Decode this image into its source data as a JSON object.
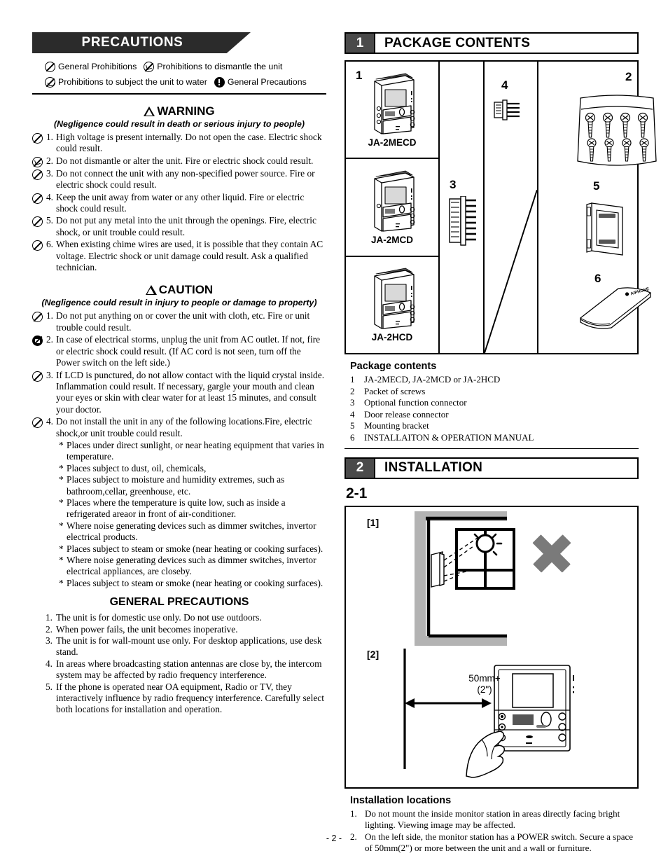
{
  "left": {
    "banner_title": "PRECAUTIONS",
    "legend": [
      {
        "icon": "general-prohibition-icon",
        "label": "General Prohibitions"
      },
      {
        "icon": "dismantle-prohibition-icon",
        "label": "Prohibitions to dismantle the unit"
      },
      {
        "icon": "water-prohibition-icon",
        "label": "Prohibitions to subject the unit to water"
      },
      {
        "icon": "general-precaution-icon",
        "label": "General Precautions"
      }
    ],
    "warning": {
      "title": "WARNING",
      "subtitle": "(Negligence could result in death or serious injury to people)",
      "items": [
        {
          "num": "1.",
          "icon": "general-prohibition-icon",
          "text": "High voltage is present internally. Do not open the case.  Electric shock could result."
        },
        {
          "num": "2.",
          "icon": "dismantle-prohibition-icon",
          "text": "Do not dismantle or alter the unit.  Fire or electric shock could result."
        },
        {
          "num": "3.",
          "icon": "general-prohibition-icon",
          "text": "Do not connect the unit with any non-specified power source. Fire or electric shock could result."
        },
        {
          "num": "4.",
          "icon": "general-prohibition-icon",
          "text": "Keep the unit away from water or any other liquid. Fire or electric shock could result."
        },
        {
          "num": "5.",
          "icon": "general-prohibition-icon",
          "text": "Do not put any metal into the unit through the openings. Fire, electric shock, or unit trouble could result."
        },
        {
          "num": "6.",
          "icon": "general-prohibition-icon",
          "text": "When existing chime wires are used, it is possible that they contain AC voltage. Electric shock or unit damage could result.  Ask a qualified technician."
        }
      ]
    },
    "caution": {
      "title": "CAUTION",
      "subtitle": "(Negligence could result in injury to people or damage to property)",
      "items": [
        {
          "num": "1.",
          "icon": "general-prohibition-icon",
          "text": "Do not put anything on or cover the unit with cloth, etc. Fire or unit trouble could result."
        },
        {
          "num": "2.",
          "icon": "unplug-precaution-icon",
          "text": "In case of electrical storms, unplug the unit from AC outlet. If not, fire or electric shock could result. (If AC cord is not seen, turn off the Power switch on the left side.)"
        },
        {
          "num": "3.",
          "icon": "general-prohibition-icon",
          "text": "If LCD is punctured, do not allow contact with the liquid crystal inside. Inflammation could result. If necessary, gargle your mouth and clean your eyes or skin with clear water for at least 15 minutes, and consult your doctor."
        },
        {
          "num": "4.",
          "icon": "general-prohibition-icon",
          "text": "Do not install the unit in any of the following locations.Fire, electric shock,or unit trouble could result."
        }
      ],
      "sub_items": [
        "Places under direct sunlight, or near heating equipment that varies in temperature.",
        "Places subject to dust, oil, chemicals,",
        "Places subject to moisture and humidity extremes, such as bathroom,cellar, greenhouse, etc.",
        "Places where the temperature is quite low, such as inside a refrigerated areaor in front of air-conditioner.",
        "Where noise generating devices such as dimmer switches, invertor electrical products.",
        "Places subject to steam or smoke (near heating or cooking surfaces).",
        "Where noise generating devices such as dimmer switches, invertor electrical appliances, are closeby.",
        "Places subject to steam or smoke (near heating or cooking surfaces)."
      ]
    },
    "general_precautions": {
      "title": "GENERAL PRECAUTIONS",
      "items": [
        {
          "num": "1.",
          "text": "The unit is for domestic use only. Do not use outdoors."
        },
        {
          "num": "2.",
          "text": "When power fails, the unit becomes inoperative."
        },
        {
          "num": "3.",
          "text": "The unit is for wall-mount use only. For desktop applications, use desk stand."
        },
        {
          "num": "4.",
          "text": "In areas where broadcasting station antennas are close by, the intercom system may be affected by radio frequency interference."
        },
        {
          "num": "5.",
          "text": "If the phone is operated near OA equipment, Radio or TV, they interactively influence by radio frequency interference. Carefully select both locations for installation and operation."
        }
      ]
    }
  },
  "right": {
    "section1": {
      "number": "1",
      "title": "PACKAGE CONTENTS",
      "diagram": {
        "monitors": [
          {
            "index": "1",
            "label": "JA-2MECD"
          },
          {
            "index": "",
            "label": "JA-2MCD"
          },
          {
            "index": "",
            "label": "JA-2HCD"
          }
        ],
        "connector_optional_index": "3",
        "connector_door_index": "4",
        "screws_index": "2",
        "bracket_index": "5",
        "manual_index": "6"
      },
      "list_title": "Package contents",
      "list": [
        {
          "n": "1",
          "text": "JA-2MECD, JA-2MCD or JA-2HCD"
        },
        {
          "n": "2",
          "text": "Packet of screws"
        },
        {
          "n": "3",
          "text": "Optional function connector"
        },
        {
          "n": "4",
          "text": "Door release connector"
        },
        {
          "n": "5",
          "text": "Mounting bracket"
        },
        {
          "n": "6",
          "text": "INSTALLAITON & OPERATION MANUAL"
        }
      ]
    },
    "section2": {
      "number": "2",
      "title": "INSTALLATION",
      "step": "2-1",
      "diagram1_label": "[1]",
      "diagram2_label": "[2]",
      "dimension_line1": "50mm+",
      "dimension_line2": "(2\")",
      "list_title": "Installation locations",
      "list": [
        {
          "n": "1.",
          "text": "Do not mount the inside monitor station in areas directly facing bright lighting. Viewing image may be affected."
        },
        {
          "n": "2.",
          "text": "On the left side, the monitor station has a POWER switch. Secure a space of 50mm(2\") or more between the unit and a wall or furniture."
        }
      ]
    }
  },
  "footer": {
    "page_number": "- 2 -"
  },
  "colors": {
    "banner_bg": "#2b2b2b",
    "section_num_bg": "#4a4a4a",
    "wall_gray": "#b3b3b3",
    "x_mark_gray": "#7a7a7a",
    "screen_gray": "#d9d9d9"
  }
}
